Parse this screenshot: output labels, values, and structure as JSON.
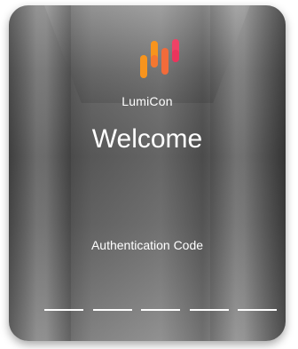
{
  "brand": {
    "name": "LumiCon",
    "logo_icon": "lumicon-bars-logo",
    "logo_colors": [
      "#F7941D",
      "#F26B3A",
      "#EE4266"
    ]
  },
  "welcome": {
    "title": "Welcome"
  },
  "auth": {
    "label": "Authentication Code",
    "code_slots": [
      "",
      "",
      "",
      "",
      ""
    ]
  }
}
